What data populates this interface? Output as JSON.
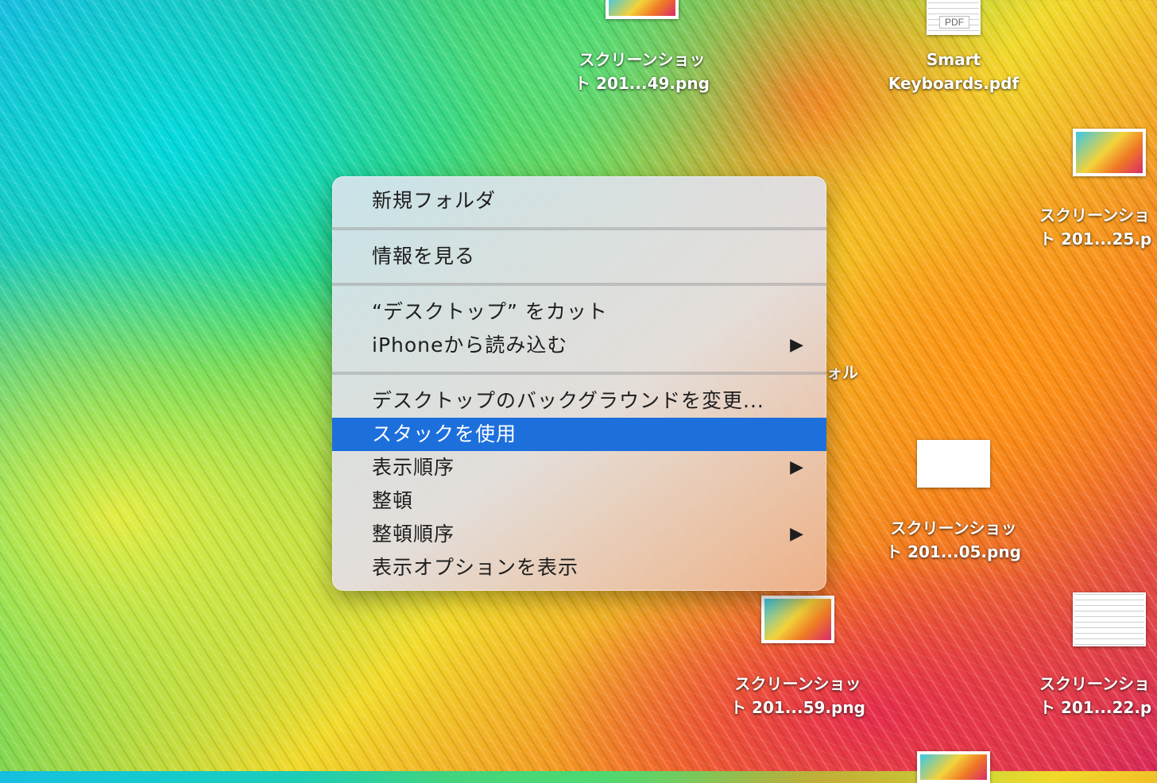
{
  "desktop": {
    "icons": [
      {
        "line1": "スクリーンショッ",
        "line2": "ト 201...49.png"
      },
      {
        "line1": "Smart",
        "line2": "Keyboards.pdf",
        "badge": "PDF"
      },
      {
        "line1": "スクリーンショ",
        "line2": "ト 201...25.p"
      },
      {
        "line1": "スクリーンショッ",
        "line2": "ト 201...05.png"
      },
      {
        "line1": "スクリーンショッ",
        "line2": "ト 201...59.png"
      },
      {
        "line1": "スクリーンショ",
        "line2": "ト 201...22.p"
      }
    ],
    "partial_label": "ォル"
  },
  "menu": {
    "items": [
      {
        "label": "新規フォルダ"
      },
      {
        "label": "情報を見る"
      },
      {
        "label": "“デスクトップ” をカット"
      },
      {
        "label": "iPhoneから読み込む",
        "submenu": "▶"
      },
      {
        "label": "デスクトップのバックグラウンドを変更..."
      },
      {
        "label": "スタックを使用",
        "highlighted": true
      },
      {
        "label": "表示順序",
        "submenu": "▶"
      },
      {
        "label": "整頓"
      },
      {
        "label": "整頓順序",
        "submenu": "▶"
      },
      {
        "label": "表示オプションを表示"
      }
    ],
    "highlight_color": "#1d6fdc"
  }
}
